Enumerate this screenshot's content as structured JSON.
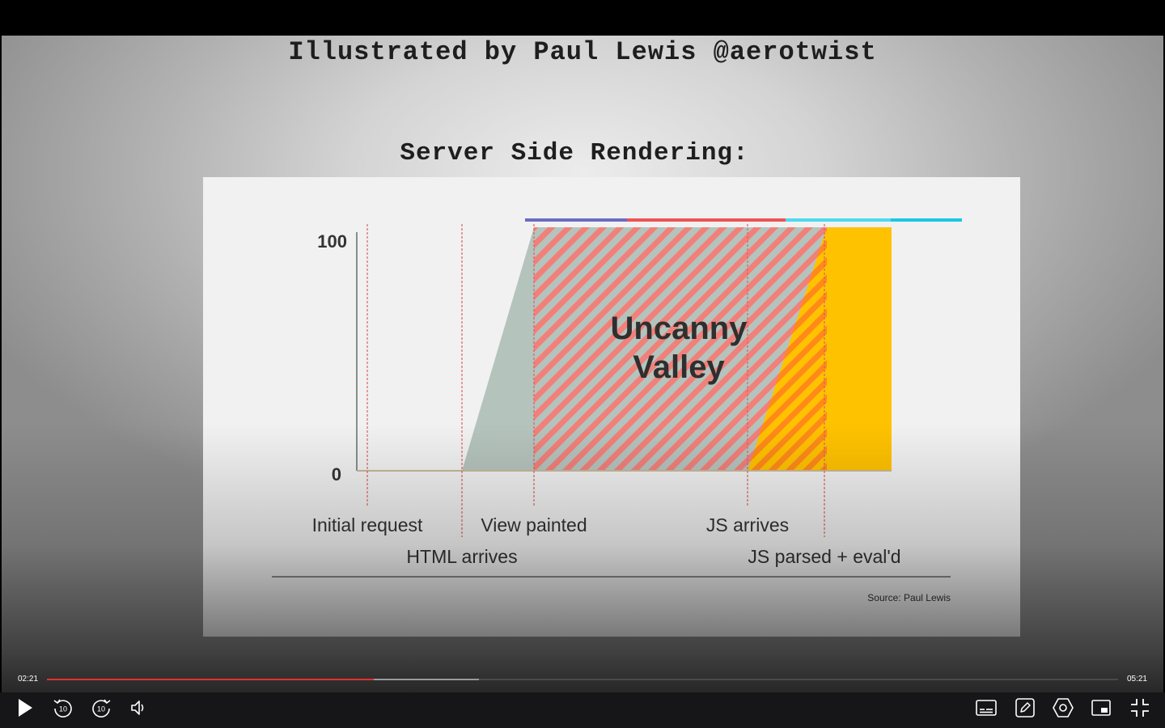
{
  "slide": {
    "title": "Illustrated by Paul Lewis @aerotwist",
    "subtitle": "Server Side Rendering:"
  },
  "chart_data": {
    "type": "area",
    "title": "",
    "ylim": [
      0,
      100
    ],
    "y_ticks": [
      "100",
      "0"
    ],
    "events": [
      {
        "label": "Initial request",
        "row": 1
      },
      {
        "label": "HTML arrives",
        "row": 2
      },
      {
        "label": "View painted",
        "row": 1
      },
      {
        "label": "JS arrives",
        "row": 1
      },
      {
        "label": "JS parsed + eval'd",
        "row": 2
      }
    ],
    "annotation": "Uncanny Valley",
    "source": "Source: Paul Lewis",
    "series": [
      {
        "name": "",
        "color": "#b5c3bd",
        "shape": "ramp from HTML arrives to View painted, then hold at 100"
      },
      {
        "name": "",
        "color": "#f2807a",
        "shape": "hatched region from View painted to JS parsed + eval'd"
      },
      {
        "name": "",
        "color": "#ffc200",
        "shape": "ramp from JS arrives to JS parsed + eval'd, then hold at 100"
      }
    ],
    "top_bars": [
      "#6b6bc4",
      "#ef5254",
      "#4dd9f0",
      "#18c8e6"
    ],
    "colors": {
      "axis": "#8c8c8c",
      "marker": "#e06060",
      "text": "#2f2f2f"
    }
  },
  "player": {
    "current_time": "02:21",
    "total_time": "05:21",
    "progress": 0.305,
    "buffered": 0.403,
    "skip_seconds": "10",
    "accent_color": "#e03131"
  }
}
